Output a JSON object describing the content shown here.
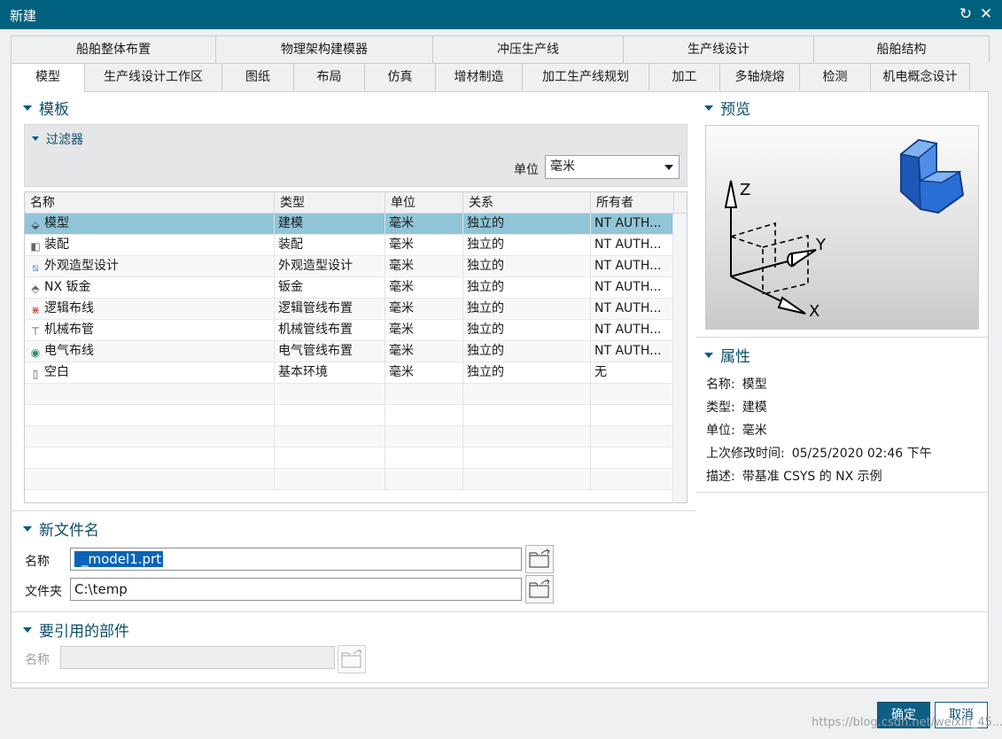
{
  "window": {
    "title": "新建",
    "refresh_icon": "↻",
    "close_icon": "✕"
  },
  "tabs_row1": [
    "船舶整体布置",
    "物理架构建模器",
    "冲压生产线",
    "生产线设计",
    "船舶结构"
  ],
  "tabs_row2": [
    "模型",
    "生产线设计工作区",
    "图纸",
    "布局",
    "仿真",
    "增材制造",
    "加工生产线规划",
    "加工",
    "多轴烧熔",
    "检测",
    "机电概念设计"
  ],
  "active_tab": "模型",
  "template_section": {
    "heading": "模板",
    "filter_heading": "过滤器",
    "unit_label": "单位",
    "unit_value": "毫米"
  },
  "table": {
    "columns": [
      "名称",
      "类型",
      "单位",
      "关系",
      "所有者"
    ],
    "rows": [
      {
        "icon": "model-icon",
        "name": "模型",
        "type": "建模",
        "unit": "毫米",
        "relation": "独立的",
        "owner": "NT AUTH..."
      },
      {
        "icon": "assembly-icon",
        "name": "装配",
        "type": "装配",
        "unit": "毫米",
        "relation": "独立的",
        "owner": "NT AUTH..."
      },
      {
        "icon": "shape-design-icon",
        "name": "外观造型设计",
        "type": "外观造型设计",
        "unit": "毫米",
        "relation": "独立的",
        "owner": "NT AUTH..."
      },
      {
        "icon": "sheet-metal-icon",
        "name": "NX 钣金",
        "type": "钣金",
        "unit": "毫米",
        "relation": "独立的",
        "owner": "NT AUTH..."
      },
      {
        "icon": "logical-routing-icon",
        "name": "逻辑布线",
        "type": "逻辑管线布置",
        "unit": "毫米",
        "relation": "独立的",
        "owner": "NT AUTH..."
      },
      {
        "icon": "mechanical-routing-icon",
        "name": "机械布管",
        "type": "机械管线布置",
        "unit": "毫米",
        "relation": "独立的",
        "owner": "NT AUTH..."
      },
      {
        "icon": "electrical-routing-icon",
        "name": "电气布线",
        "type": "电气管线布置",
        "unit": "毫米",
        "relation": "独立的",
        "owner": "NT AUTH..."
      },
      {
        "icon": "blank-icon",
        "name": "空白",
        "type": "基本环境",
        "unit": "毫米",
        "relation": "独立的",
        "owner": "无"
      }
    ],
    "selected_row": 0
  },
  "preview_section": {
    "heading": "预览",
    "axis_z": "Z",
    "axis_y": "Y",
    "axis_x": "X"
  },
  "properties_section": {
    "heading": "属性",
    "items": [
      {
        "label": "名称:",
        "value": "模型"
      },
      {
        "label": "类型:",
        "value": "建模"
      },
      {
        "label": "单位:",
        "value": "毫米"
      },
      {
        "label": "上次修改时间:",
        "value": "05/25/2020 02:46 下午"
      },
      {
        "label": "描述:",
        "value": "带基准 CSYS 的 NX 示例"
      }
    ]
  },
  "new_file_section": {
    "heading": "新文件名",
    "name_label": "名称",
    "name_value": "_model1.prt",
    "folder_label": "文件夹",
    "folder_value": "C:\\temp"
  },
  "ref_section": {
    "heading": "要引用的部件",
    "name_label": "名称",
    "name_value": ""
  },
  "buttons": {
    "ok": "确定",
    "cancel": "取消"
  },
  "watermark": "https://blog.csdn.net/weixin_45..."
}
